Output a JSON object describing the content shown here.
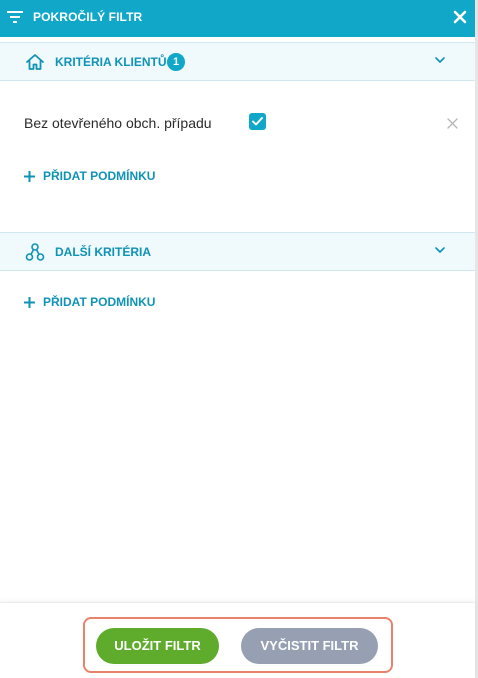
{
  "header": {
    "title": "POKROČILÝ FILTR",
    "filter_icon": "filter-lines-icon",
    "close_icon": "close-icon"
  },
  "sections": [
    {
      "title": "KRITÉRIA KLIENTŮ",
      "badge": "1",
      "icon": "home-icon",
      "chevron_icon": "chevron-down-icon",
      "conditions": [
        {
          "label": "Bez otevřeného obch. případu",
          "checked": true,
          "remove_icon": "close-icon"
        }
      ],
      "add_label": "PŘIDAT PODMÍNKU"
    },
    {
      "title": "DALŠÍ KRITÉRIA",
      "icon": "share-nodes-icon",
      "chevron_icon": "chevron-down-icon",
      "conditions": [],
      "add_label": "PŘIDAT PODMÍNKU"
    }
  ],
  "footer": {
    "save_label": "ULOŽIT FILTR",
    "clear_label": "VYČISTIT FILTR"
  },
  "colors": {
    "header_bg": "#10a7c9",
    "accent": "#0f93b6",
    "save_button": "#5fac2c",
    "clear_button": "#97a0b3",
    "highlight_frame": "#e9826a"
  }
}
